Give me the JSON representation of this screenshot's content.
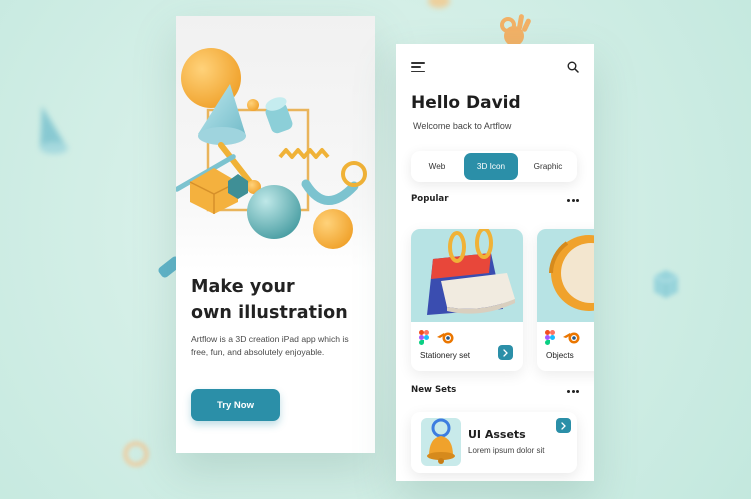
{
  "colors": {
    "background": "#d4efe7",
    "accent": "#2b8fa8",
    "card_teal": "#b7e3e4",
    "text_dark": "#1e1e1e"
  },
  "onboarding": {
    "title_line1": "Make your",
    "title_line2": "own illustration",
    "description": "Artflow is a 3D creation iPad app which is free, fun, and absolutely enjoyable.",
    "cta_label": "Try Now"
  },
  "home": {
    "menu_icon": "hamburger-menu-icon",
    "search_icon": "search-icon",
    "greeting": "Hello David",
    "subtitle": "Welcome back to Artflow",
    "tabs": [
      {
        "label": "Web",
        "selected": false
      },
      {
        "label": "3D Icon",
        "selected": true
      },
      {
        "label": "Graphic",
        "selected": false
      }
    ],
    "popular": {
      "title": "Popular",
      "more_icon": "more-dots-icon",
      "cards": [
        {
          "name": "Stationery set",
          "image_icon": "calendar-3d-icon",
          "tool_icons": [
            "figma-icon",
            "blender-icon"
          ],
          "arrow_icon": "chevron-right-icon"
        },
        {
          "name": "Objects",
          "image_icon": "clock-3d-icon",
          "tool_icons": [
            "figma-icon",
            "blender-icon"
          ]
        }
      ]
    },
    "new_sets": {
      "title": "New Sets",
      "more_icon": "more-dots-icon",
      "items": [
        {
          "title": "UI Assets",
          "subtitle": "Lorem ipsum dolor sit",
          "image_icon": "bell-3d-icon",
          "arrow_icon": "chevron-right-icon"
        }
      ]
    }
  }
}
